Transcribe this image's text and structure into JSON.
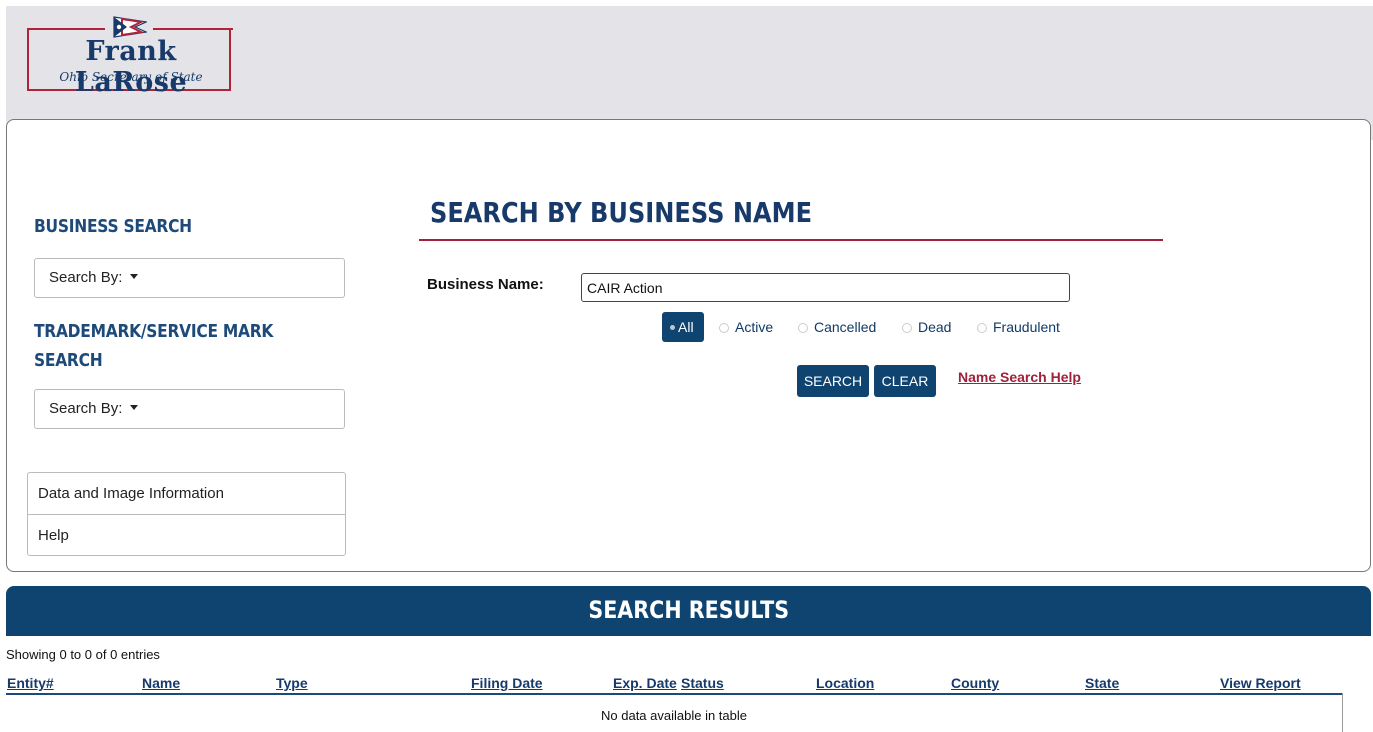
{
  "logo": {
    "name": "Frank LaRose",
    "subtitle": "Ohio Secretary of State"
  },
  "sidebar": {
    "business_heading": "BUSINESS SEARCH",
    "business_dropdown": "Search By:",
    "trademark_heading_line1": "TRADEMARK/SERVICE MARK",
    "trademark_heading_line2": "SEARCH",
    "trademark_dropdown": "Search By:",
    "links": [
      {
        "label": "Data and Image Information"
      },
      {
        "label": "Help"
      }
    ]
  },
  "search": {
    "title": "SEARCH BY BUSINESS NAME",
    "business_name_label": "Business Name:",
    "business_name_value": "CAIR Action",
    "status_options": [
      {
        "label": "All",
        "selected": true
      },
      {
        "label": "Active",
        "selected": false
      },
      {
        "label": "Cancelled",
        "selected": false
      },
      {
        "label": "Dead",
        "selected": false
      },
      {
        "label": "Fraudulent",
        "selected": false
      }
    ],
    "search_button": "SEARCH",
    "clear_button": "CLEAR",
    "help_link": "Name Search Help"
  },
  "results": {
    "title": "SEARCH RESULTS",
    "showing": "Showing 0 to 0 of 0 entries",
    "columns": [
      "Entity#",
      "Name",
      "Type",
      "Filing Date",
      "Exp. Date",
      "Status",
      "Location",
      "County",
      "State",
      "View Report"
    ],
    "empty_message": "No data available in table"
  },
  "colors": {
    "navy": "#0f4470",
    "heading_blue": "#1d4a78",
    "accent_red": "#a1203c",
    "top_bar": "#e4e4e8"
  }
}
